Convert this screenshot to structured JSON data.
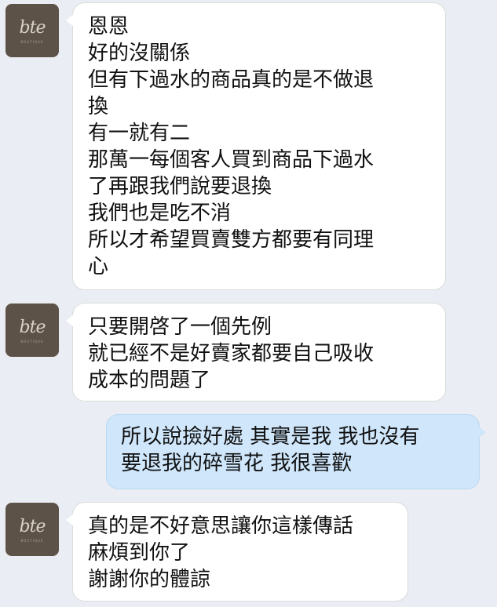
{
  "avatar": {
    "logo_text": "bte",
    "logo_subtext": "BOUTIQUE"
  },
  "messages": [
    {
      "sender": "incoming",
      "text": "恩恩\n好的沒關係\n但有下過水的商品真的是不做退\n換\n有一就有二\n那萬一每個客人買到商品下過水\n了再跟我們說要退換\n我們也是吃不消\n所以才希望買賣雙方都要有同理\n心"
    },
    {
      "sender": "incoming",
      "text": "只要開啓了一個先例\n就已經不是好賣家都要自己吸收\n成本的問題了"
    },
    {
      "sender": "outgoing",
      "text": "所以說撿好處 其實是我 我也沒有\n要退我的碎雪花 我很喜歡"
    },
    {
      "sender": "incoming",
      "text": "真的是不好意思讓你這樣傳話\n麻煩到你了\n謝謝你的體諒"
    }
  ]
}
